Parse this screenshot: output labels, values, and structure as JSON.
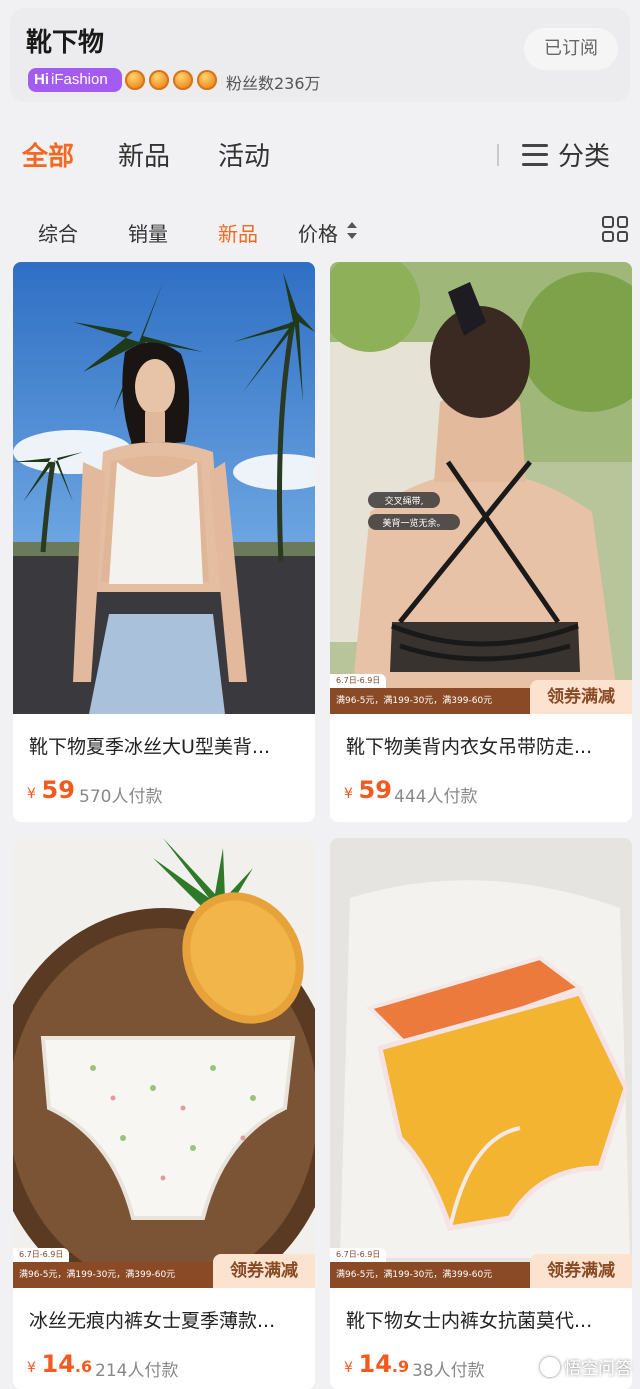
{
  "shop": {
    "name": "靴下物",
    "badge_hi": "Hi",
    "badge_text": "iFashion",
    "fans": "粉丝数236万",
    "subscribe": "已订阅"
  },
  "tabs": {
    "all": "全部",
    "new": "新品",
    "activity": "活动",
    "category": "分类"
  },
  "sort": {
    "overall": "综合",
    "sales": "销量",
    "new": "新品",
    "price": "价格"
  },
  "colors": {
    "accent": "#f26a22",
    "price": "#f25a1e",
    "promo": "#8a4a25"
  },
  "products": [
    {
      "title": "靴下物夏季冰丝大U型美背...",
      "currency": "¥",
      "price": "59",
      "sold": "570人付款",
      "promo": null
    },
    {
      "title": "靴下物美背内衣女吊带防走...",
      "currency": "¥",
      "price": "59",
      "sold": "444人付款",
      "img_text1": "交叉绳带,",
      "img_text2": "美背一览无余。",
      "promo": {
        "date": "6.7日-6.9日",
        "bar": "满96-5元，满199-30元，满399-60元",
        "badge": "领券满减"
      }
    },
    {
      "title": "冰丝无痕内裤女士夏季薄款...",
      "currency": "¥",
      "price_int": "14",
      "price_dec": ".6",
      "sold": "214人付款",
      "promo": {
        "date": "6.7日-6.9日",
        "bar": "满96-5元，满199-30元，满399-60元",
        "badge": "领券满减"
      }
    },
    {
      "title": "靴下物女士内裤女抗菌莫代...",
      "currency": "¥",
      "price_int": "14",
      "price_dec": ".9",
      "sold": "38人付款",
      "promo": {
        "date": "6.7日-6.9日",
        "bar": "满96-5元，满199-30元，满399-60元",
        "badge": "领券满减"
      }
    }
  ],
  "watermark": "悟空问答"
}
